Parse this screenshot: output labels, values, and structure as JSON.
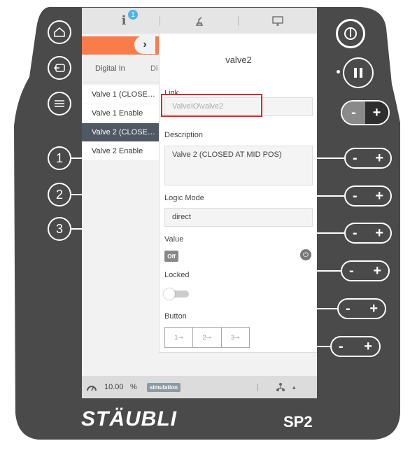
{
  "topbar": {
    "info_badge": "1"
  },
  "left_panel": {
    "collapse_icon": "chevron-right-icon",
    "tabs": [
      {
        "label": "Digital In"
      },
      {
        "label": "Di"
      }
    ],
    "items": [
      {
        "label": "Valve 1 (CLOSED ..."
      },
      {
        "label": "Valve 1 Enable"
      },
      {
        "label": "Valve 2 (CLOSED ..."
      },
      {
        "label": "Valve 2 Enable"
      }
    ]
  },
  "detail": {
    "title": "valve2",
    "link_label": "Link",
    "link_value": "ValveIO\\valve2",
    "description_label": "Description",
    "description_value": "Valve 2 (CLOSED AT MID POS)",
    "logic_mode_label": "Logic Mode",
    "logic_mode_value": "direct",
    "value_label": "Value",
    "value_state": "Off",
    "locked_label": "Locked",
    "button_label": "Button",
    "buttons": [
      "1",
      "2",
      "3"
    ]
  },
  "statusbar": {
    "speed": "10.00",
    "unit": "%",
    "mode": "simulation"
  },
  "pendant": {
    "brand": "STÄUBLI",
    "model": "SP2",
    "side_numbers": [
      "1",
      "2",
      "3"
    ],
    "jog_pills": [
      {
        "minus": "-",
        "plus": "+"
      }
    ]
  },
  "colors": {
    "accent": "#f97c4a",
    "highlight": "#e0242c",
    "body": "#4a4a4a"
  }
}
